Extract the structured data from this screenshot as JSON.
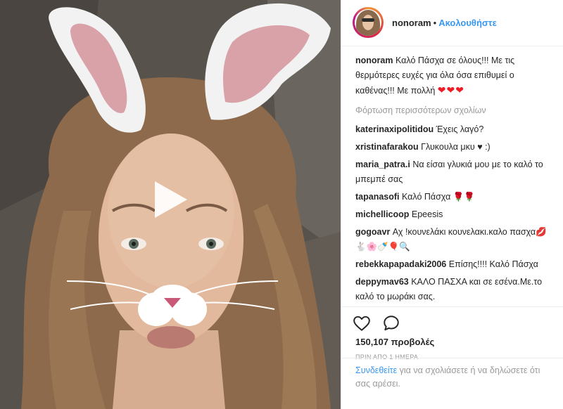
{
  "post": {
    "owner": "nonoram",
    "follow_label": "Ακολουθήστε",
    "separator": "•",
    "caption_text": "Καλό Πάσχα σε όλους!!! Με τις θερμότερες ευχές για όλα όσα επιθυμεί ο καθένας!!! Με πολλή",
    "caption_hearts": "❤❤❤",
    "load_more": "Φόρτωση περισσότερων σχολίων"
  },
  "comments": [
    {
      "user": "katerinaxipolitidou",
      "text": "Έχεις λαγό?"
    },
    {
      "user": "xristinafarakou",
      "text": "Γλυκουλα μκυ ♥ :)"
    },
    {
      "user": "maria_patra.i",
      "text": "Να είσαι γλυκιά μου με το καλό το μπεμπέ σας"
    },
    {
      "user": "tapanasofi",
      "text": "Καλό Πάσχα 🌹🌹"
    },
    {
      "user": "michellicoop",
      "text": "Epeesis"
    },
    {
      "user": "gogoavr",
      "text": "Αχ !κουνελάκι κουνελακι.καλο πασχα💋🐇🌸🍼🎈🔍"
    },
    {
      "user": "rebekkapapadaki2006",
      "text": "Επίσης!!!! Καλό Πάσχα"
    },
    {
      "user": "deppymav63",
      "text": "ΚΑΛΟ ΠΑΣΧΑ και σε εσένα.Με.το καλό το μωράκι σας."
    }
  ],
  "stats": {
    "views": "150,107 προβολές",
    "time": "ΠΡΙΝ ΑΠΟ 1 ΗΜΕΡΑ"
  },
  "login_prompt": {
    "link": "Συνδεθείτε",
    "rest": " για να σχολιάσετε ή να δηλώσετε ότι σας αρέσει."
  },
  "icons": {
    "play": "play-icon",
    "like": "heart-outline-icon",
    "comment": "comment-bubble-icon"
  },
  "colors": {
    "accent": "#3897f0",
    "text": "#262626",
    "muted": "#999999",
    "hearts": "#ed1c24"
  }
}
